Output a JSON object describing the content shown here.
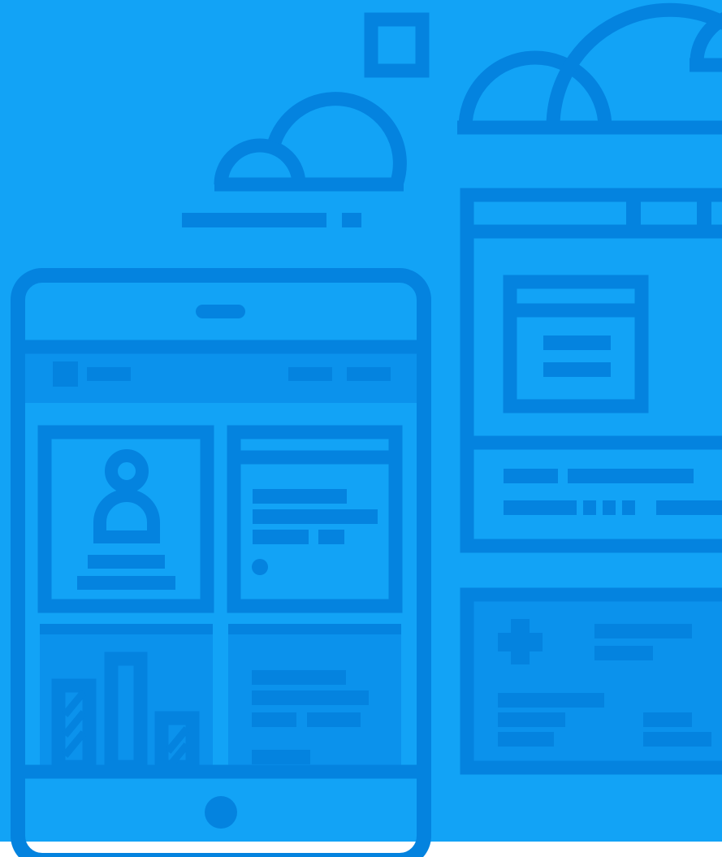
{
  "colors": {
    "background": "#12A3F6",
    "line": "#0483DF",
    "panel_fill": "#0B92EC",
    "bottom_strip": "#FFFFFF"
  },
  "icons": [
    "cloud-icon",
    "square-icon",
    "user-avatar-icon",
    "bar-chart-icon",
    "plus-icon",
    "home-button-icon"
  ]
}
